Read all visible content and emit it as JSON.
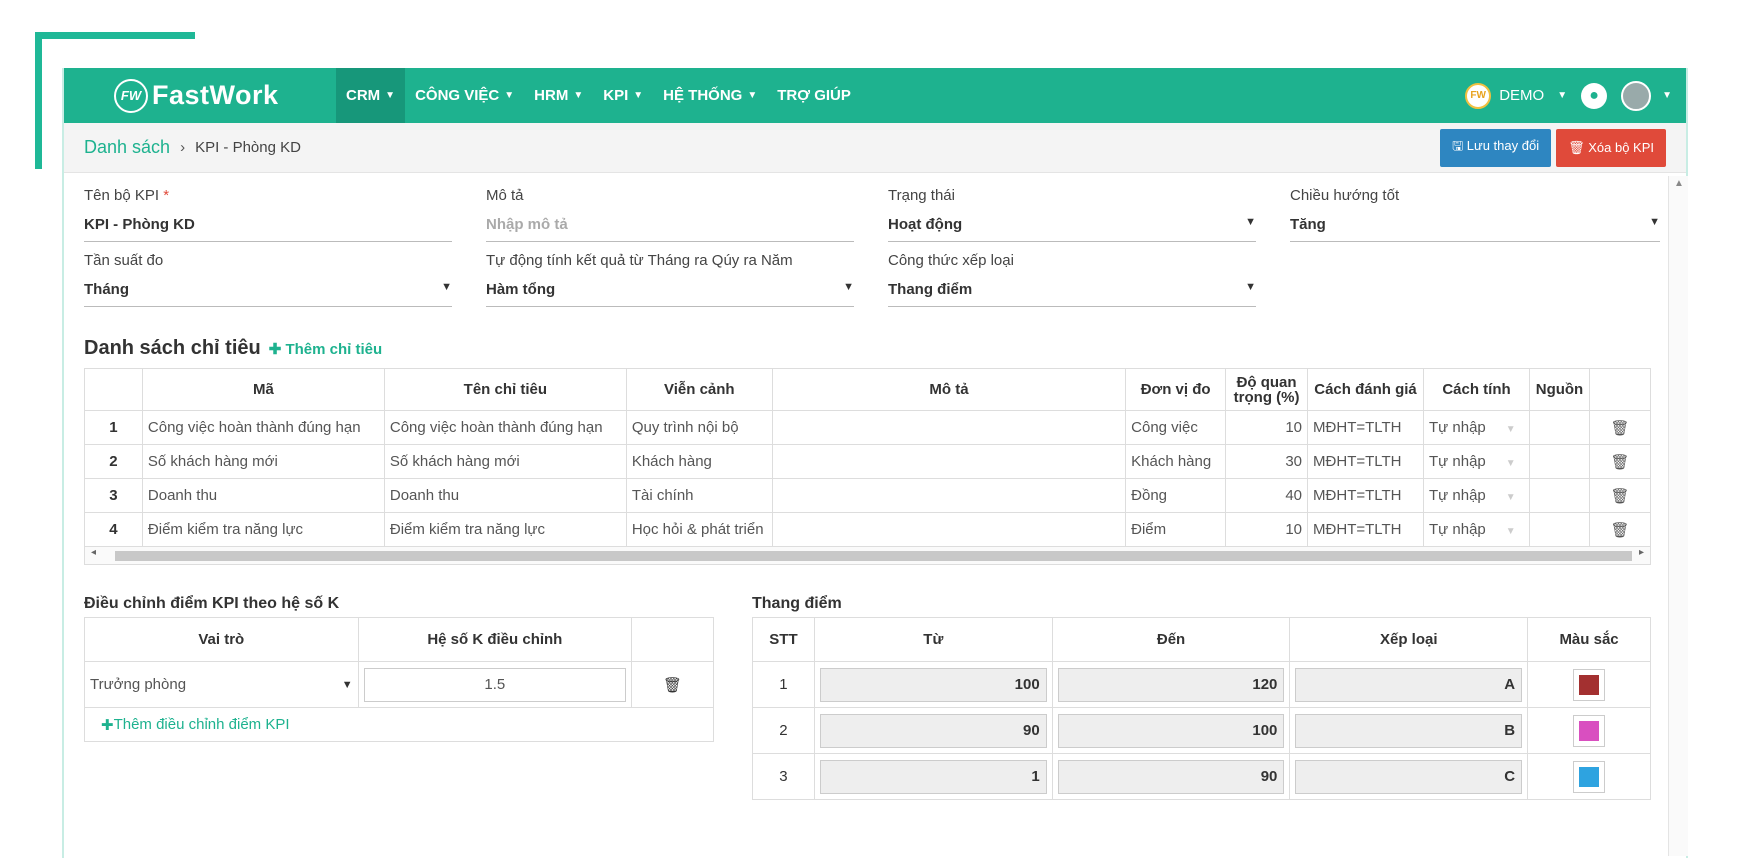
{
  "brand": {
    "logo_badge": "FW",
    "name": "FastWork"
  },
  "nav": [
    {
      "label": "CRM",
      "caret": true,
      "active": true
    },
    {
      "label": "CÔNG VIỆC",
      "caret": true
    },
    {
      "label": "HRM",
      "caret": true
    },
    {
      "label": "KPI",
      "caret": true
    },
    {
      "label": "HỆ THỐNG",
      "caret": true
    },
    {
      "label": "TRỢ GIÚP",
      "caret": false
    }
  ],
  "account": {
    "badge": "FW",
    "label": "DEMO"
  },
  "breadcrumb": {
    "root": "Danh sách",
    "sep": "›",
    "current": "KPI - Phòng KD"
  },
  "actions": {
    "save": "Lưu thay đổi",
    "delete": "Xóa bộ KPI"
  },
  "form": {
    "kpi_name": {
      "label": "Tên bộ KPI",
      "required": "*",
      "value": "KPI - Phòng KD"
    },
    "description": {
      "label": "Mô tả",
      "placeholder": "Nhập mô tả"
    },
    "status": {
      "label": "Trạng thái",
      "value": "Hoạt động"
    },
    "direction": {
      "label": "Chiều hướng tốt",
      "value": "Tăng"
    },
    "frequency": {
      "label": "Tần suất đo",
      "value": "Tháng"
    },
    "auto_calc": {
      "label": "Tự động tính kết quả từ Tháng ra Qúy ra Năm",
      "value": "Hàm tổng"
    },
    "grading": {
      "label": "Công thức xếp loại",
      "value": "Thang điểm"
    }
  },
  "indicators": {
    "title": "Danh sách chỉ tiêu",
    "add": "Thêm chỉ tiêu",
    "headers": {
      "code": "Mã",
      "name": "Tên chỉ tiêu",
      "perspective": "Viễn cảnh",
      "desc": "Mô tả",
      "unit": "Đơn vị đo",
      "weight": "Độ quan trọng (%)",
      "eval": "Cách đánh giá",
      "calc": "Cách tính",
      "source": "Nguồn"
    },
    "rows": [
      {
        "no": "1",
        "code": "Công việc hoàn thành đúng hạn",
        "name": "Công việc hoàn thành đúng hạn",
        "perspective": "Quy trình nội bộ",
        "desc": "",
        "unit": "Công việc",
        "weight": "10",
        "eval": "MĐHT=TLTH",
        "calc": "Tự nhập",
        "source": ""
      },
      {
        "no": "2",
        "code": "Số khách hàng mới",
        "name": "Số khách hàng mới",
        "perspective": "Khách hàng",
        "desc": "",
        "unit": "Khách hàng",
        "weight": "30",
        "eval": "MĐHT=TLTH",
        "calc": "Tự nhập",
        "source": ""
      },
      {
        "no": "3",
        "code": "Doanh thu",
        "name": "Doanh thu",
        "perspective": "Tài chính",
        "desc": "",
        "unit": "Đồng",
        "weight": "40",
        "eval": "MĐHT=TLTH",
        "calc": "Tự nhập",
        "source": ""
      },
      {
        "no": "4",
        "code": "Điểm kiểm tra năng lực",
        "name": "Điểm kiểm tra năng lực",
        "perspective": "Học hỏi & phát triển",
        "desc": "",
        "unit": "Điểm",
        "weight": "10",
        "eval": "MĐHT=TLTH",
        "calc": "Tự nhập",
        "source": ""
      }
    ]
  },
  "kadjust": {
    "title": "Điều chỉnh điểm KPI theo hệ số K",
    "headers": {
      "role": "Vai trò",
      "coef": "Hệ số K điều chỉnh"
    },
    "rows": [
      {
        "role": "Trưởng phòng",
        "coef": "1.5"
      }
    ],
    "add": "Thêm điều chỉnh điểm KPI"
  },
  "scale": {
    "title": "Thang điểm",
    "headers": {
      "stt": "STT",
      "from": "Từ",
      "to": "Đến",
      "grade": "Xếp loại",
      "color": "Màu sắc"
    },
    "rows": [
      {
        "stt": "1",
        "from": "100",
        "to": "120",
        "grade": "A",
        "color": "#a33030"
      },
      {
        "stt": "2",
        "from": "90",
        "to": "100",
        "grade": "B",
        "color": "#d94fc0"
      },
      {
        "stt": "3",
        "from": "1",
        "to": "90",
        "grade": "C",
        "color": "#2ea3e0"
      }
    ]
  },
  "colors": {
    "accent": "#1eb28f",
    "danger": "#e04a3a",
    "primary": "#2e86c1"
  }
}
